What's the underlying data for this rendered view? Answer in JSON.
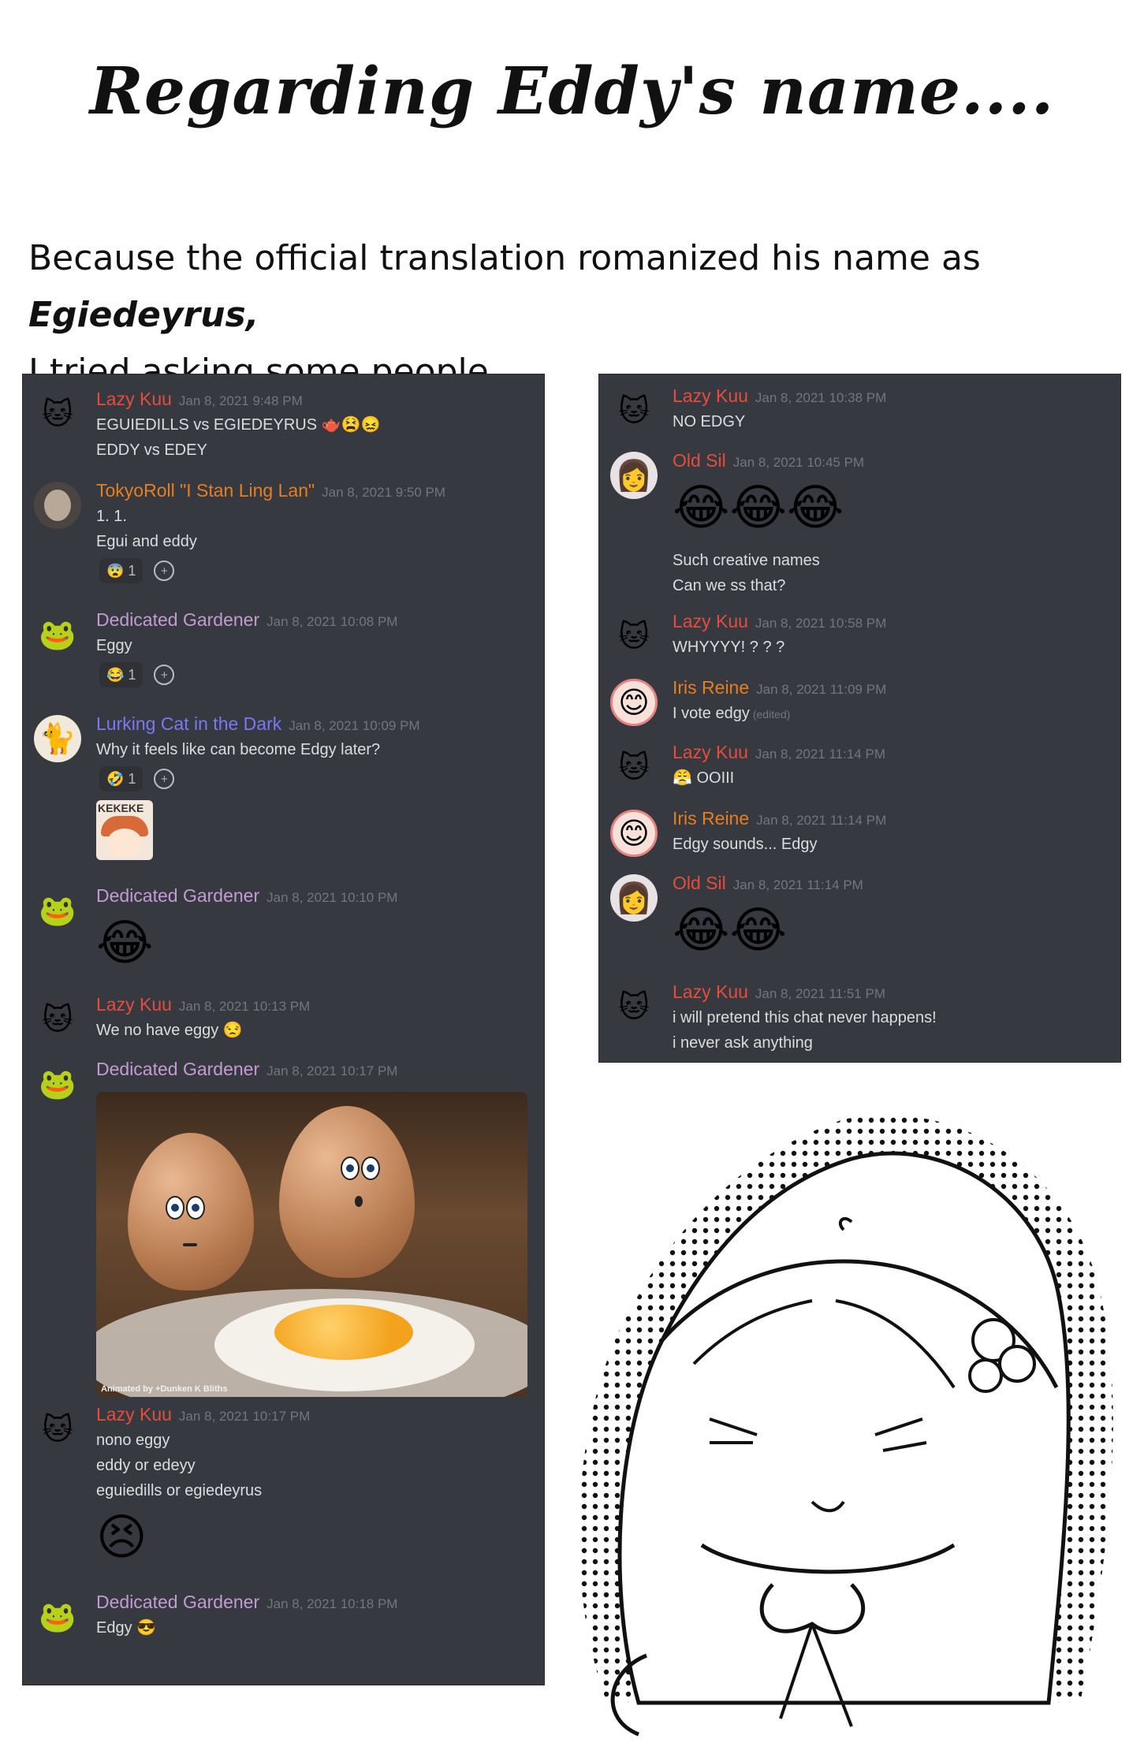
{
  "title": "Regarding Eddy's name....",
  "intro": {
    "before": "Because the official translation romanized his name as ",
    "emphasis": "Egiedeyrus,",
    "line2": "I tried asking some people..."
  },
  "left_chat": [
    {
      "author": "Lazy Kuu",
      "time": "Jan 8, 2021 9:48 PM",
      "lines": [
        "EGUIEDILLS vs EGIEDEYRUS 🫖😫😖",
        "EDDY vs EDEY"
      ]
    },
    {
      "author": "TokyoRoll \"I Stan Ling Lan\"",
      "time": "Jan 8, 2021 9:50 PM",
      "lines": [
        "1. 1.",
        "Egui and eddy"
      ],
      "reaction": {
        "emoji": "😨",
        "count": "1"
      }
    },
    {
      "author": "Dedicated Gardener",
      "time": "Jan 8, 2021 10:08 PM",
      "lines": [
        "Eggy"
      ],
      "reaction": {
        "emoji": "😂",
        "count": "1"
      }
    },
    {
      "author": "Lurking Cat in the Dark",
      "time": "Jan 8, 2021 10:09 PM",
      "lines": [
        "Why it feels like can become Edgy later?"
      ],
      "reaction": {
        "emoji": "🤣",
        "count": "1"
      },
      "sticker_text": "KEKEKE"
    },
    {
      "author": "Dedicated Gardener",
      "time": "Jan 8, 2021 10:10 PM",
      "emoji": "😂"
    },
    {
      "author": "Lazy Kuu",
      "time": "Jan 8, 2021 10:13 PM",
      "lines": [
        "We no have eggy 😒"
      ]
    },
    {
      "author": "Dedicated Gardener",
      "time": "Jan 8, 2021 10:17 PM",
      "image_caption": "Animated by +Dunken K Bliths"
    },
    {
      "author": "Lazy Kuu",
      "time": "Jan 8, 2021 10:17 PM",
      "lines": [
        "nono eggy",
        "eddy or edeyy",
        "eguiedills or egiedeyrus"
      ],
      "emoji": "😣"
    },
    {
      "author": "Dedicated Gardener",
      "time": "Jan 8, 2021 10:18 PM",
      "lines": [
        "Edgy 😎"
      ]
    }
  ],
  "right_chat": [
    {
      "author": "Lazy Kuu",
      "time": "Jan 8, 2021 10:38 PM",
      "lines": [
        "NO EDGY"
      ]
    },
    {
      "author": "Old Sil",
      "time": "Jan 8, 2021 10:45 PM",
      "emoji": "😂😂😂",
      "lines": [
        "Such creative names",
        "Can we ss that?"
      ]
    },
    {
      "author": "Lazy Kuu",
      "time": "Jan 8, 2021 10:58 PM",
      "lines": [
        "WHYYYY! ? ? ?"
      ]
    },
    {
      "author": "Iris Reine",
      "time": "Jan 8, 2021 11:09 PM",
      "lines": [
        "I vote edgy"
      ],
      "edited": "(edited)"
    },
    {
      "author": "Lazy Kuu",
      "time": "Jan 8, 2021 11:14 PM",
      "lines": [
        "😤 OOIII"
      ]
    },
    {
      "author": "Iris Reine",
      "time": "Jan 8, 2021 11:14 PM",
      "lines": [
        "Edgy sounds... Edgy"
      ]
    },
    {
      "author": "Old Sil",
      "time": "Jan 8, 2021 11:14 PM",
      "emoji": "😂😂"
    },
    {
      "author": "Lazy Kuu",
      "time": "Jan 8, 2021 11:51 PM",
      "lines": [
        "i will pretend this chat never happens!",
        "i never ask anything"
      ]
    }
  ],
  "colors": {
    "chat_bg": "#36393f",
    "text": "#dcddde",
    "timestamp": "#72767d",
    "lazy_kuu": "#e74c3c",
    "tokyoroll": "#e67e22",
    "dedicated_gardener": "#c39bd3",
    "lurking_cat": "#7a78f2",
    "old_sil": "#e74c3c",
    "iris_reine": "#e67e22"
  },
  "icons": {
    "add_reaction": "add-reaction-icon",
    "lazy_kuu_avatar": "🐱",
    "dedicated_gardener_avatar": "🐸",
    "lurking_cat_avatar": "🐈",
    "old_sil_avatar": "👩",
    "iris_reine_avatar": "😊"
  }
}
